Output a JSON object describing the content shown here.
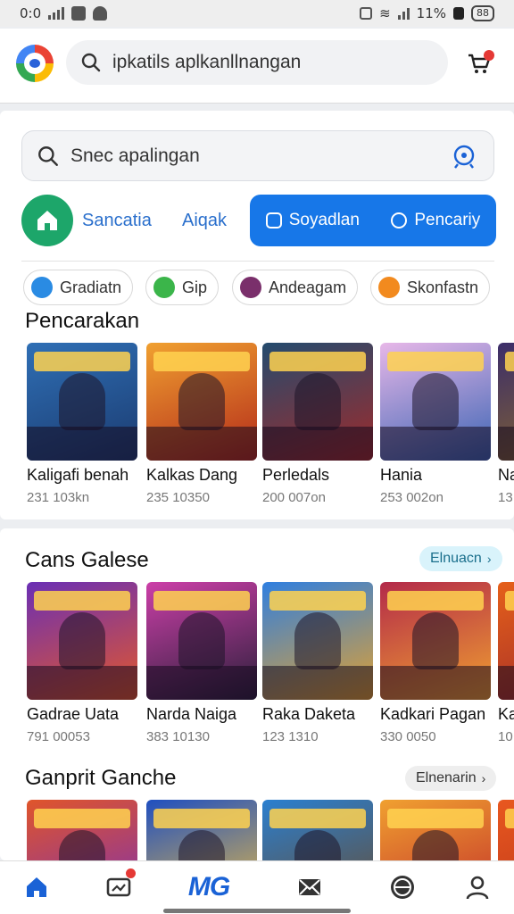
{
  "status_bar": {
    "time": "0:0",
    "battery": "88",
    "battery_pct": "11%"
  },
  "top_search": {
    "text": "ipkatils aplkanllnangan"
  },
  "search2": {
    "text": "Snec apalingan"
  },
  "tabs": {
    "tab1": "Sancatia",
    "tab2": "Aiqak",
    "tab3": "Soyadlan",
    "tab4": "Pencariy"
  },
  "chips": [
    {
      "label": "Gradiatn",
      "color": "#2a8be3"
    },
    {
      "label": "Gip",
      "color": "#3bb54a"
    },
    {
      "label": "Andeagam",
      "color": "#7a2f6b"
    },
    {
      "label": "Skonfastn",
      "color": "#f28a1e"
    }
  ],
  "section1": {
    "title": "Pencarakan",
    "games": [
      {
        "name": "Kaligafi benah",
        "meta": "231 103kn",
        "color1": "#2f6fb5",
        "color2": "#1b3b70"
      },
      {
        "name": "Kalkas Dang",
        "meta": "235 10350",
        "color1": "#f0a030",
        "color2": "#b32a1a"
      },
      {
        "name": "Perledals",
        "meta": "200 007on",
        "color1": "#244b6e",
        "color2": "#a02a2a"
      },
      {
        "name": "Hania",
        "meta": "253 002on",
        "color1": "#e7b7e8",
        "color2": "#3a64b4"
      },
      {
        "name": "Na",
        "meta": "13",
        "color1": "#3b2d6a",
        "color2": "#8c6a2a"
      }
    ]
  },
  "section2": {
    "title": "Cans Galese",
    "button": "Elnuacn",
    "games": [
      {
        "name": "Gadrae Uata",
        "meta": "791 00053",
        "color1": "#6a2fb5",
        "color2": "#e4582a"
      },
      {
        "name": "Narda Naiga",
        "meta": "383 10130",
        "color1": "#cc3fa8",
        "color2": "#2a1f3a"
      },
      {
        "name": "Raka Daketa",
        "meta": "123 1310",
        "color1": "#2f7fe0",
        "color2": "#e3a12f"
      },
      {
        "name": "Kadkari Pagan",
        "meta": "330 0050",
        "color1": "#b32a4a",
        "color2": "#f0a030"
      },
      {
        "name": "Ka",
        "meta": "10",
        "color1": "#e5601a",
        "color2": "#a02a2a"
      }
    ]
  },
  "section3": {
    "title": "Ganprit Ganche",
    "button": "Elnenarin",
    "games": [
      {
        "color1": "#e0552a",
        "color2": "#7a2fb5"
      },
      {
        "color1": "#1f4fc0",
        "color2": "#f0c040"
      },
      {
        "color1": "#2a7fd0",
        "color2": "#6a4a2a"
      },
      {
        "color1": "#f0a030",
        "color2": "#c02a2a"
      },
      {
        "color1": "#e8581f",
        "color2": "#b8321a"
      }
    ]
  },
  "nav": {
    "accent": "#1a62d6",
    "items": [
      "home-icon",
      "messages-icon",
      "games-icon",
      "mail-icon",
      "explore-icon",
      "profile-icon"
    ],
    "center_label": "MG"
  }
}
